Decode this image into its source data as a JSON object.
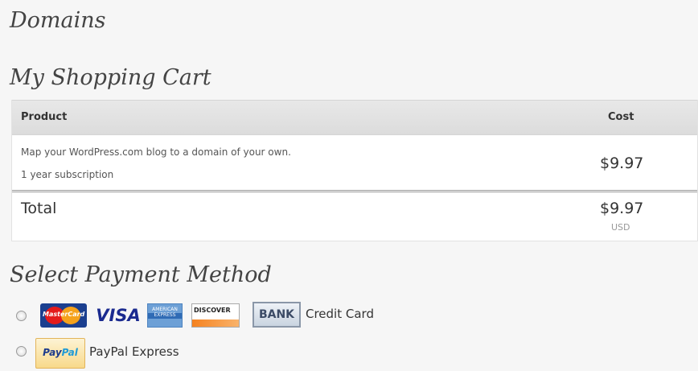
{
  "page": {
    "domains_heading": "Domains",
    "cart_heading": "My Shopping Cart",
    "payment_heading": "Select Payment Method"
  },
  "cart": {
    "columns": {
      "product": "Product",
      "cost": "Cost"
    },
    "item": {
      "description": "Map your WordPress.com blog to a domain of your own.",
      "term": "1 year subscription",
      "price": "$9.97"
    },
    "total": {
      "label": "Total",
      "price": "$9.97",
      "currency": "USD"
    }
  },
  "payment": {
    "options": [
      {
        "label": "Credit Card",
        "selected": false,
        "logos": {
          "mastercard": "MasterCard",
          "visa": "VISA",
          "amex": "AMERICAN EXPRESS",
          "discover": "DISCOVER",
          "bank": "BANK"
        }
      },
      {
        "label": "PayPal Express",
        "selected": false,
        "logos": {
          "paypal_a": "Pay",
          "paypal_b": "Pal"
        }
      }
    ]
  }
}
